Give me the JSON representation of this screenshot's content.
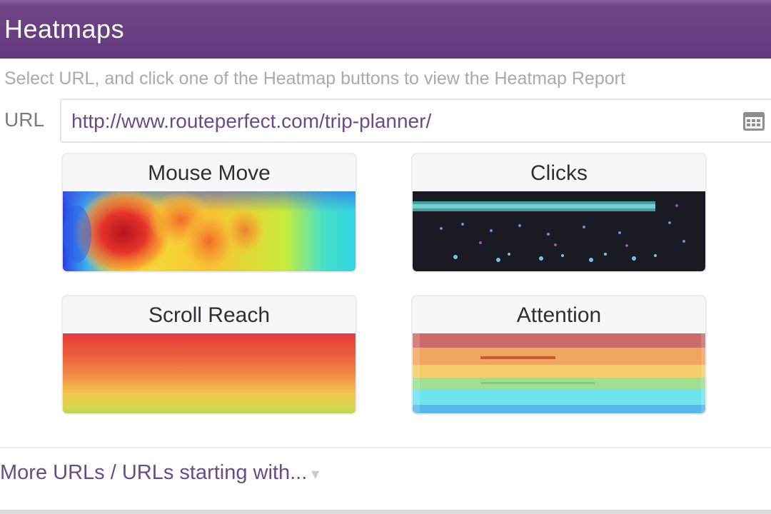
{
  "header": {
    "title": "Heatmaps"
  },
  "instruction": "Select URL, and click one of the Heatmap buttons to view the Heatmap Report",
  "url": {
    "label": "URL",
    "value": "http://www.routeperfect.com/trip-planner/",
    "icon": "calendar-icon"
  },
  "cards": {
    "mouse_move": {
      "label": "Mouse Move"
    },
    "clicks": {
      "label": "Clicks"
    },
    "scroll_reach": {
      "label": "Scroll Reach"
    },
    "attention": {
      "label": "Attention"
    }
  },
  "footer": {
    "more_link": "More URLs / URLs starting with...",
    "chevron_icon": "chevron-down-icon"
  },
  "colors": {
    "header_bg": "#643a7e",
    "link": "#6b4a86"
  }
}
